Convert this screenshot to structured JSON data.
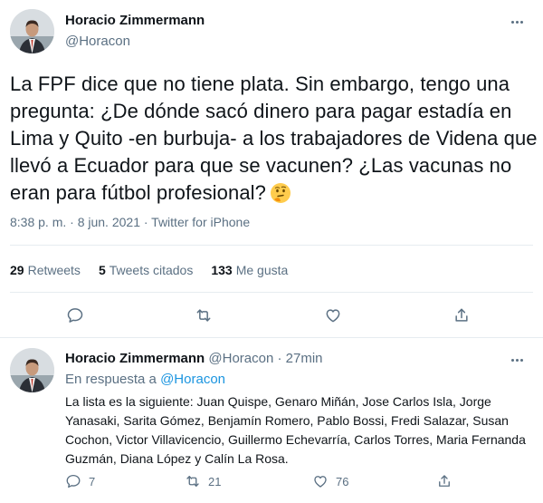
{
  "tweet": {
    "author_name": "Horacio Zimmermann",
    "handle": "@Horacon",
    "text": "La FPF dice que no tiene plata. Sin embargo, tengo una pregunta: ¿De dónde sacó dinero para pagar estadía en Lima y Quito -en burbuja- a los trabajadores de Videna que llevó a Ecuador para que se vacunen? ¿Las vacunas no eran para fútbol profesional?",
    "emoji": "thinking-face",
    "timestamp": "8:38 p. m. · 8 jun. 2021 · Twitter for iPhone",
    "stats": {
      "retweets_count": "29",
      "retweets_label": "Retweets",
      "quotes_count": "5",
      "quotes_label": "Tweets citados",
      "likes_count": "133",
      "likes_label": "Me gusta"
    },
    "actions": [
      "reply-icon",
      "retweet-icon",
      "like-icon",
      "share-icon"
    ]
  },
  "reply": {
    "author_name": "Horacio Zimmermann",
    "handle": "@Horacon",
    "separator": "·",
    "time": "27min",
    "in_reply_prefix": "En respuesta a",
    "in_reply_handle": "@Horacon",
    "text": "La lista es la siguiente: Juan Quispe, Genaro Miñán, Jose Carlos Isla, Jorge Yanasaki, Sarita Gómez, Benjamín Romero, Pablo Bossi, Fredi Salazar, Susan Cochon, Victor Villavicencio, Guillermo Echevarría, Carlos Torres, Maria Fernanda Guzmán, Diana López y Calín La Rosa.",
    "reply_count": "7",
    "retweet_count": "21",
    "like_count": "76"
  },
  "colors": {
    "text": "#0f1419",
    "secondary": "#5b7083",
    "link": "#1b95e0",
    "divider": "#e6ecf0"
  }
}
